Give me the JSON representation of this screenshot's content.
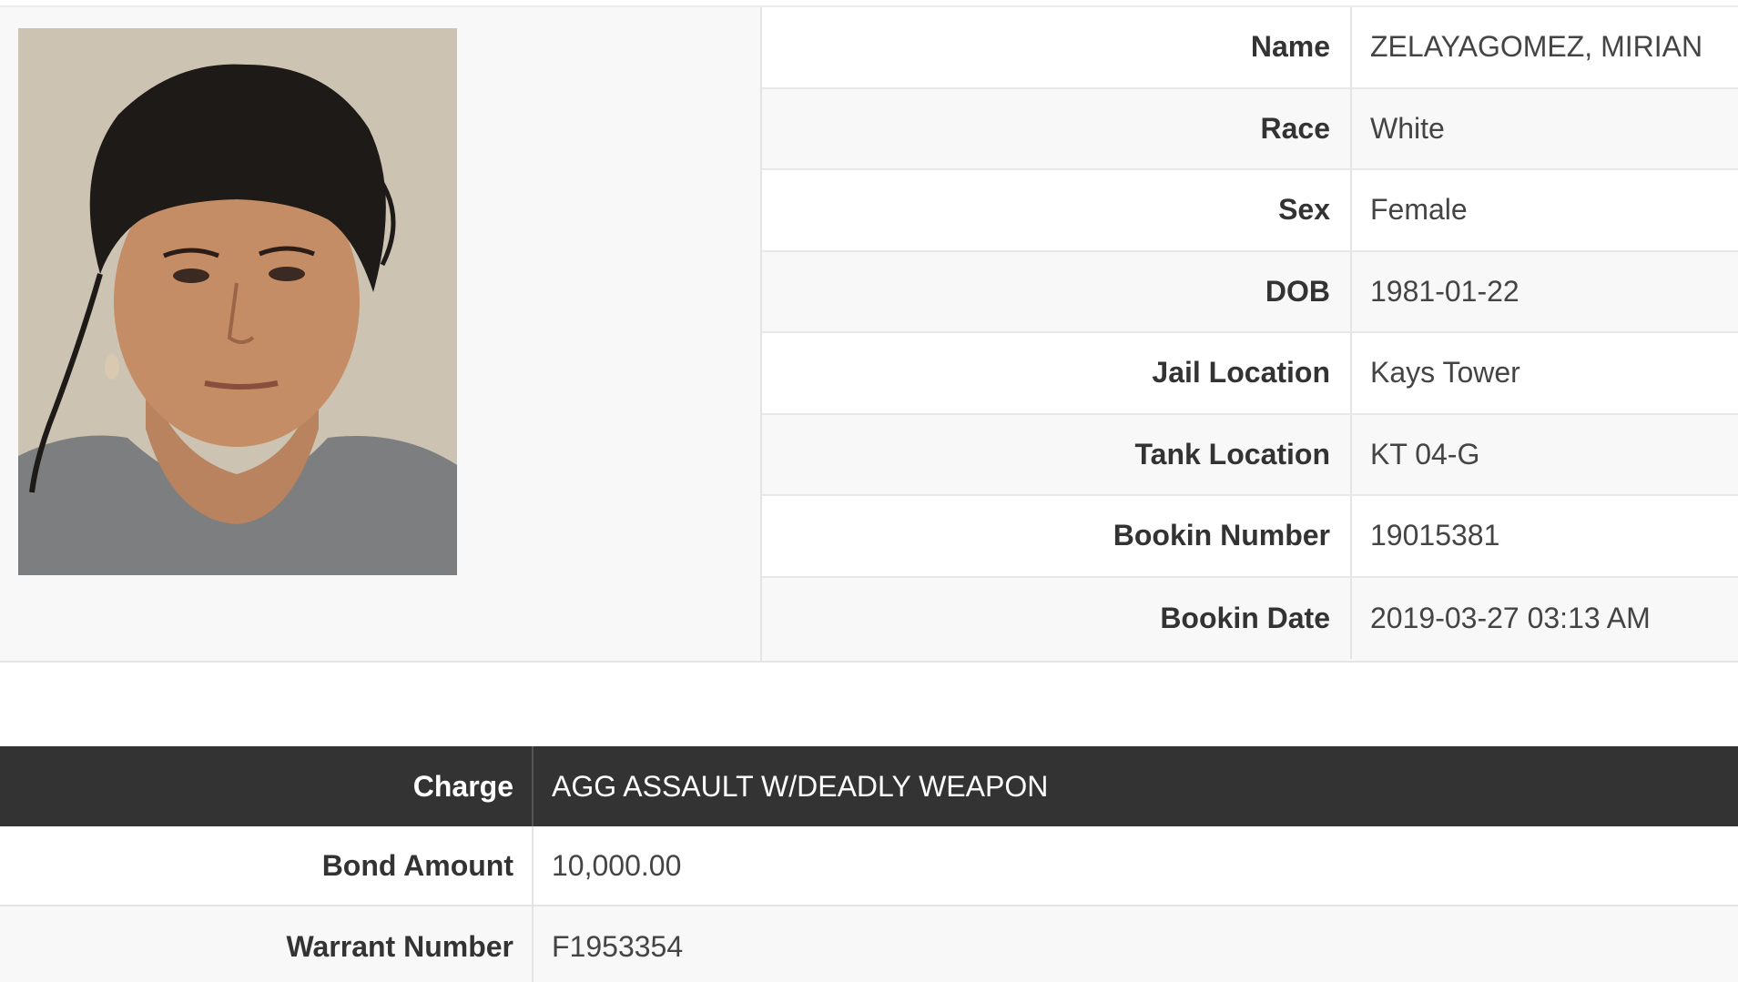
{
  "inmate": {
    "photo_alt": "",
    "rows": [
      {
        "label": "Name",
        "value": "ZELAYAGOMEZ, MIRIAN"
      },
      {
        "label": "Race",
        "value": "White"
      },
      {
        "label": "Sex",
        "value": "Female"
      },
      {
        "label": "DOB",
        "value": "1981-01-22"
      },
      {
        "label": "Jail Location",
        "value": "Kays Tower"
      },
      {
        "label": "Tank Location",
        "value": "KT 04-G"
      },
      {
        "label": "Bookin Number",
        "value": "19015381"
      },
      {
        "label": "Bookin Date",
        "value": "2019-03-27 03:13 AM"
      }
    ]
  },
  "charges": {
    "rows": [
      {
        "label": "Charge",
        "value": "AGG ASSAULT W/DEADLY WEAPON"
      },
      {
        "label": "Bond Amount",
        "value": "10,000.00"
      },
      {
        "label": "Warrant Number",
        "value": "F1953354"
      }
    ]
  },
  "colors": {
    "header_bg": "#333333",
    "row_alt_bg": "#f8f8f8",
    "border": "#e4e4e4"
  }
}
